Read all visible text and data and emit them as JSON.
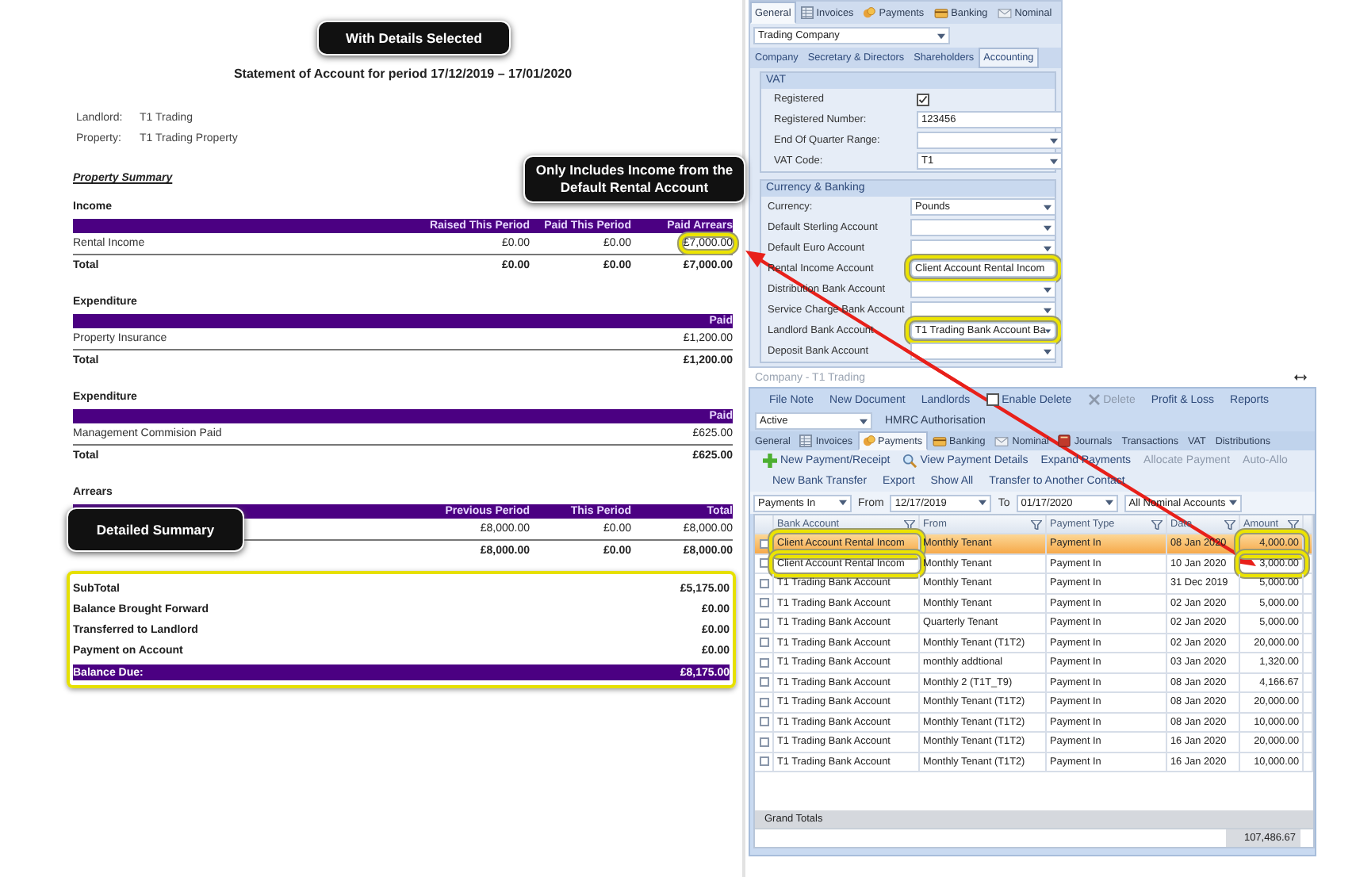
{
  "callouts": [
    {
      "text": "With Details Selected"
    },
    {
      "text": "Only Includes Income from the Default Rental Account"
    },
    {
      "text": "Detailed Summary"
    }
  ],
  "statement": {
    "title": "Statement of Account for period 17/12/2019 – 17/01/2020",
    "details": [
      {
        "label": "Landlord:",
        "value": "T1 Trading"
      },
      {
        "label": "Property:",
        "value": "T1 Trading Property"
      }
    ],
    "summary_title": "Property Summary",
    "sections": [
      {
        "heading": "Income",
        "columns": [
          "Raised This Period",
          "Paid This Period",
          "Paid Arrears"
        ],
        "rows": [
          {
            "label": "Rental Income",
            "values": [
              "£0.00",
              "£0.00",
              "£7,000.00"
            ],
            "marked": true
          }
        ],
        "total": {
          "label": "Total",
          "values": [
            "£0.00",
            "£0.00",
            "£7,000.00"
          ]
        }
      },
      {
        "heading": "Expenditure",
        "columns": [
          "Paid"
        ],
        "rows": [
          {
            "label": "Property Insurance",
            "values": [
              "£1,200.00"
            ],
            "marked": false
          }
        ],
        "total": {
          "label": "Total",
          "values": [
            "£1,200.00"
          ]
        }
      },
      {
        "heading": "Expenditure",
        "columns": [
          "Paid"
        ],
        "rows": [
          {
            "label": "Management Commision Paid",
            "values": [
              "£625.00"
            ],
            "marked": false
          }
        ],
        "total": {
          "label": "Total",
          "values": [
            "£625.00"
          ]
        }
      },
      {
        "heading": "Arrears",
        "columns": [
          "Previous Period",
          "This Period",
          "Total"
        ],
        "rows": [
          {
            "values": [
              "£8,000.00",
              "£0.00",
              "£8,000.00"
            ],
            "marked": false
          }
        ],
        "total": {
          "values": [
            "£8,000.00",
            "£0.00",
            "£8,000.00"
          ]
        }
      }
    ],
    "balance": {
      "marked": true,
      "lines": [
        {
          "kind": "line",
          "label": "SubTotal",
          "value": "£5,175.00"
        },
        {
          "kind": "line",
          "label": "Balance Brought Forward",
          "value": "£0.00"
        },
        {
          "kind": "line",
          "label": "Transferred to Landlord",
          "value": "£0.00"
        },
        {
          "kind": "line",
          "label": "Payment on Account",
          "value": "£0.00"
        },
        {
          "kind": "due",
          "label": "Balance Due:",
          "value": "£8,175.00"
        }
      ]
    }
  },
  "company_panel": {
    "tabs": [
      {
        "label": "General",
        "kind": "plain",
        "selected": true
      },
      {
        "label": "Invoices",
        "kind": "ledger",
        "selected": false
      },
      {
        "label": "Payments",
        "kind": "coins",
        "selected": false
      },
      {
        "label": "Banking",
        "kind": "card",
        "selected": false
      },
      {
        "label": "Nominal",
        "kind": "envelope",
        "selected": false
      }
    ],
    "type_dropdown": "Trading Company",
    "subtabs": [
      {
        "label": "Company",
        "selected": false
      },
      {
        "label": "Secretary & Directors",
        "selected": false
      },
      {
        "label": "Shareholders",
        "selected": false
      },
      {
        "label": "Accounting",
        "selected": true
      }
    ],
    "groups": [
      {
        "title": "VAT",
        "fields": [
          {
            "kind": "checkbox",
            "label": "Registered",
            "checked": true
          },
          {
            "kind": "text",
            "label": "Registered Number:",
            "value": "123456",
            "marked": false
          },
          {
            "kind": "dropdown",
            "label": "End Of Quarter Range:",
            "marked": false
          },
          {
            "kind": "dropdown",
            "label": "VAT Code:",
            "value": "T1",
            "marked": false
          }
        ]
      },
      {
        "title": "Currency & Banking",
        "fields": [
          {
            "kind": "dropdown",
            "label": "Currency:",
            "value": "Pounds",
            "marked": false
          },
          {
            "kind": "dropdown",
            "label": "Default Sterling Account",
            "marked": false
          },
          {
            "kind": "dropdown",
            "label": "Default Euro Account",
            "marked": false
          },
          {
            "kind": "text",
            "label": "Rental Income Account",
            "value": "Client Account Rental Incom",
            "marked": true
          },
          {
            "kind": "dropdown",
            "label": "Distribution Bank Account",
            "marked": false
          },
          {
            "kind": "dropdown",
            "label": "Service Charge Bank Account",
            "marked": false
          },
          {
            "kind": "dropdown",
            "label": "Landlord Bank Account",
            "value": "T1 Trading Bank Account  Ba",
            "marked": true
          },
          {
            "kind": "dropdown",
            "label": "Deposit Bank Account",
            "marked": false
          }
        ]
      }
    ]
  },
  "main_window": {
    "title": "Company - T1 Trading",
    "toolbar": [
      {
        "kind": "button",
        "label": "File Note",
        "disabled": false
      },
      {
        "kind": "button",
        "label": "New Document",
        "disabled": false
      },
      {
        "kind": "button",
        "label": "Landlords",
        "disabled": false
      },
      {
        "kind": "checkbox",
        "label": "Enable Delete",
        "checked": false,
        "disabled": false
      },
      {
        "kind": "delete",
        "label": "Delete",
        "disabled": true
      },
      {
        "kind": "button",
        "label": "Profit & Loss",
        "disabled": false
      },
      {
        "kind": "button",
        "label": "Reports",
        "disabled": false
      }
    ],
    "status_dropdown": "Active",
    "hmrc_button": "HMRC Authorisation",
    "tabs": [
      {
        "label": "General",
        "kind": "plain",
        "selected": false
      },
      {
        "label": "Invoices",
        "kind": "ledger",
        "selected": false
      },
      {
        "label": "Payments",
        "kind": "coins",
        "selected": true
      },
      {
        "label": "Banking",
        "kind": "card",
        "selected": false
      },
      {
        "label": "Nominal",
        "kind": "envelope",
        "selected": false
      },
      {
        "label": "Journals",
        "kind": "book",
        "selected": false
      },
      {
        "label": "Transactions",
        "kind": "plain",
        "selected": false
      },
      {
        "label": "VAT",
        "kind": "plain",
        "selected": false
      },
      {
        "label": "Distributions",
        "kind": "plain",
        "selected": false
      }
    ],
    "actions": [
      {
        "kind": "add",
        "label": "New Payment/Receipt",
        "disabled": false
      },
      {
        "kind": "search",
        "label": "View Payment Details",
        "disabled": false
      },
      {
        "kind": "plain",
        "label": "Expand Payments",
        "disabled": false
      },
      {
        "kind": "plain",
        "label": "Allocate Payment",
        "disabled": true
      },
      {
        "kind": "plain",
        "label": "Auto-Allo",
        "disabled": true
      }
    ],
    "actions_2": [
      {
        "label": "New Bank Transfer"
      },
      {
        "label": "Export"
      },
      {
        "label": "Show All"
      },
      {
        "label": "Transfer to Another Contact"
      }
    ],
    "filters": {
      "direction": "Payments In",
      "from_label": "From",
      "from": "12/17/2019",
      "to_label": "To",
      "to": "01/17/2020",
      "account": "All Nominal Accounts"
    },
    "table": {
      "columns": [
        "Bank Account",
        "From",
        "Payment Type",
        "Date",
        "Amount"
      ],
      "rows": [
        {
          "bank_account": "Client Account Rental Incom",
          "from": "Monthly Tenant",
          "payment_type": "Payment In",
          "date": "08 Jan 2020",
          "amount": "4,000.00",
          "selected": true,
          "marked": true
        },
        {
          "bank_account": "Client Account Rental Incom",
          "from": "Monthly Tenant",
          "payment_type": "Payment In",
          "date": "10 Jan 2020",
          "amount": "3,000.00",
          "selected": false,
          "marked": true
        },
        {
          "bank_account": "T1 Trading Bank Account",
          "from": "Monthly Tenant",
          "payment_type": "Payment In",
          "date": "31 Dec 2019",
          "amount": "5,000.00",
          "selected": false,
          "marked": false
        },
        {
          "bank_account": "T1 Trading Bank Account",
          "from": "Monthly Tenant",
          "payment_type": "Payment In",
          "date": "02 Jan 2020",
          "amount": "5,000.00",
          "selected": false,
          "marked": false
        },
        {
          "bank_account": "T1 Trading Bank Account",
          "from": "Quarterly Tenant",
          "payment_type": "Payment In",
          "date": "02 Jan 2020",
          "amount": "5,000.00",
          "selected": false,
          "marked": false
        },
        {
          "bank_account": "T1 Trading Bank Account",
          "from": "Monthly Tenant (T1T2)",
          "payment_type": "Payment In",
          "date": "02 Jan 2020",
          "amount": "20,000.00",
          "selected": false,
          "marked": false
        },
        {
          "bank_account": "T1 Trading Bank Account",
          "from": "monthly addtional",
          "payment_type": "Payment In",
          "date": "03 Jan 2020",
          "amount": "1,320.00",
          "selected": false,
          "marked": false
        },
        {
          "bank_account": "T1 Trading Bank Account",
          "from": "Monthly 2 (T1T_T9)",
          "payment_type": "Payment In",
          "date": "08 Jan 2020",
          "amount": "4,166.67",
          "selected": false,
          "marked": false
        },
        {
          "bank_account": "T1 Trading Bank Account",
          "from": "Monthly Tenant (T1T2)",
          "payment_type": "Payment In",
          "date": "08 Jan 2020",
          "amount": "20,000.00",
          "selected": false,
          "marked": false
        },
        {
          "bank_account": "T1 Trading Bank Account",
          "from": "Monthly Tenant (T1T2)",
          "payment_type": "Payment In",
          "date": "08 Jan 2020",
          "amount": "10,000.00",
          "selected": false,
          "marked": false
        },
        {
          "bank_account": "T1 Trading Bank Account",
          "from": "Monthly Tenant (T1T2)",
          "payment_type": "Payment In",
          "date": "16 Jan 2020",
          "amount": "20,000.00",
          "selected": false,
          "marked": false
        },
        {
          "bank_account": "T1 Trading Bank Account",
          "from": "Monthly Tenant (T1T2)",
          "payment_type": "Payment In",
          "date": "16 Jan 2020",
          "amount": "10,000.00",
          "selected": false,
          "marked": false
        }
      ],
      "totals_label": "Grand Totals",
      "grand_total": "107,486.67"
    }
  }
}
